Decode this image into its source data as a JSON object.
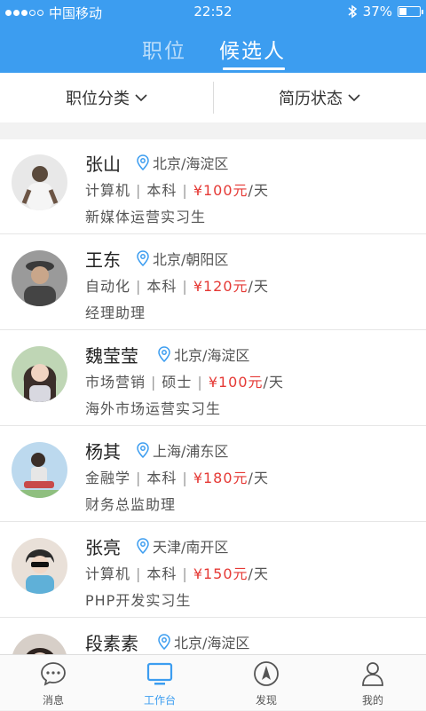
{
  "status": {
    "carrier": "中国移动",
    "time": "22:52",
    "battery": "37%",
    "battery_level": 0.37
  },
  "tabs": [
    {
      "label": "职位",
      "active": false
    },
    {
      "label": "候选人",
      "active": true
    }
  ],
  "filters": [
    {
      "label": "职位分类"
    },
    {
      "label": "简历状态"
    }
  ],
  "candidates": [
    {
      "name": "张山",
      "location": "北京/海淀区",
      "major": "计算机",
      "degree": "本科",
      "price": "¥100元",
      "unit": "/天",
      "position": "新媒体运营实习生"
    },
    {
      "name": "王东",
      "location": "北京/朝阳区",
      "major": "自动化",
      "degree": "本科",
      "price": "¥120元",
      "unit": "/天",
      "position": "经理助理"
    },
    {
      "name": "魏莹莹",
      "location": "北京/海淀区",
      "major": "市场营销",
      "degree": "硕士",
      "price": "¥100元",
      "unit": "/天",
      "position": "海外市场运营实习生"
    },
    {
      "name": "杨其",
      "location": "上海/浦东区",
      "major": "金融学",
      "degree": "本科",
      "price": "¥180元",
      "unit": "/天",
      "position": "财务总监助理"
    },
    {
      "name": "张亮",
      "location": "天津/南开区",
      "major": "计算机",
      "degree": "本科",
      "price": "¥150元",
      "unit": "/天",
      "position": "PHP开发实习生"
    },
    {
      "name": "段素素",
      "location": "北京/海淀区"
    }
  ],
  "tabbar": [
    {
      "label": "消息",
      "icon": "chat-icon",
      "active": false
    },
    {
      "label": "工作台",
      "icon": "monitor-icon",
      "active": true
    },
    {
      "label": "发现",
      "icon": "compass-icon",
      "active": false
    },
    {
      "label": "我的",
      "icon": "person-icon",
      "active": false
    }
  ],
  "colors": {
    "primary": "#3c9df0",
    "price": "#e53935"
  }
}
